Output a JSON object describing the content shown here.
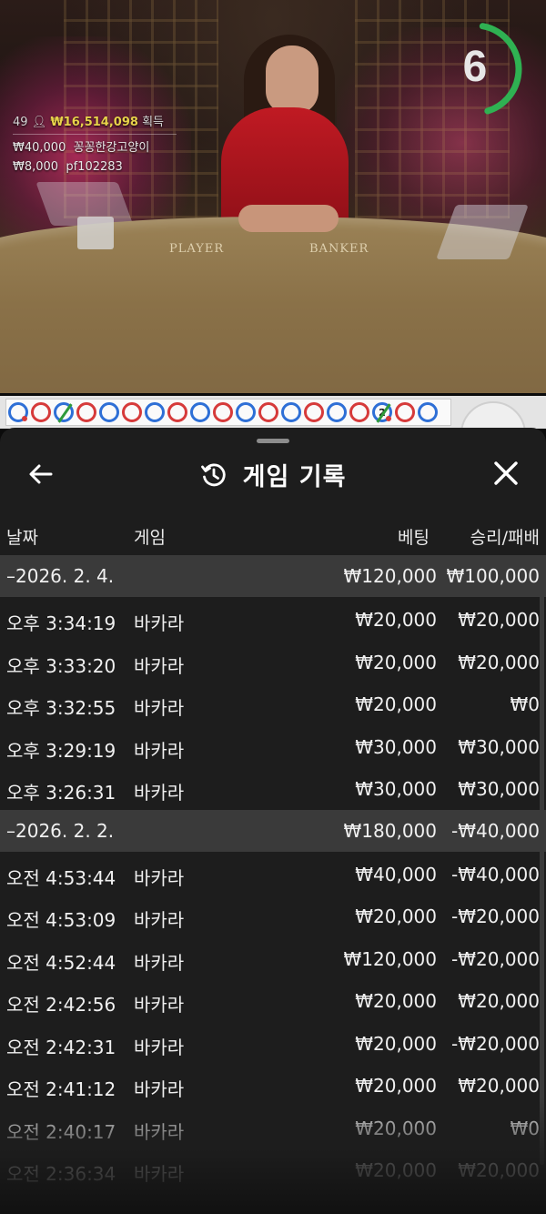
{
  "video": {
    "felt_player": "PLAYER",
    "felt_banker": "BANKER",
    "timer": "6",
    "timer_progress": 0.85,
    "winners": {
      "count": "49",
      "total": "₩16,514,098",
      "suffix": "획득",
      "entries": [
        {
          "amount": "₩40,000",
          "name": "꽁꽁한강고양이"
        },
        {
          "amount": "₩8,000",
          "name": "pf102283"
        }
      ]
    }
  },
  "road": {
    "beads": [
      "P",
      "B",
      "P-tie",
      "B",
      "P",
      "B",
      "P",
      "B",
      "P",
      "B",
      "P",
      "B",
      "P",
      "B",
      "P",
      "B",
      "P-tie-2",
      "B",
      "P"
    ]
  },
  "sheet": {
    "title": "게임 기록",
    "columns": {
      "date": "날짜",
      "game": "게임",
      "bet": "베팅",
      "result": "승리/패배"
    },
    "groups": [
      {
        "date": "–2026. 2. 4.",
        "bet": "₩120,000",
        "result": "₩100,000",
        "rows": [
          {
            "time": "오후 3:34:19",
            "game": "바카라",
            "bet": "₩20,000",
            "result": "₩20,000"
          },
          {
            "time": "오후 3:33:20",
            "game": "바카라",
            "bet": "₩20,000",
            "result": "₩20,000"
          },
          {
            "time": "오후 3:32:55",
            "game": "바카라",
            "bet": "₩20,000",
            "result": "₩0"
          },
          {
            "time": "오후 3:29:19",
            "game": "바카라",
            "bet": "₩30,000",
            "result": "₩30,000"
          },
          {
            "time": "오후 3:26:31",
            "game": "바카라",
            "bet": "₩30,000",
            "result": "₩30,000"
          }
        ]
      },
      {
        "date": "–2026. 2. 2.",
        "bet": "₩180,000",
        "result": "-₩40,000",
        "rows": [
          {
            "time": "오전 4:53:44",
            "game": "바카라",
            "bet": "₩40,000",
            "result": "-₩40,000"
          },
          {
            "time": "오전 4:53:09",
            "game": "바카라",
            "bet": "₩20,000",
            "result": "-₩20,000"
          },
          {
            "time": "오전 4:52:44",
            "game": "바카라",
            "bet": "₩120,000",
            "result": "-₩20,000"
          },
          {
            "time": "오전 2:42:56",
            "game": "바카라",
            "bet": "₩20,000",
            "result": "₩20,000"
          },
          {
            "time": "오전 2:42:31",
            "game": "바카라",
            "bet": "₩20,000",
            "result": "-₩20,000"
          },
          {
            "time": "오전 2:41:12",
            "game": "바카라",
            "bet": "₩20,000",
            "result": "₩20,000"
          },
          {
            "time": "오전 2:40:17",
            "game": "바카라",
            "bet": "₩20,000",
            "result": "₩0"
          },
          {
            "time": "오전 2:36:34",
            "game": "바카라",
            "bet": "₩20,000",
            "result": "₩20,000"
          }
        ]
      }
    ]
  }
}
